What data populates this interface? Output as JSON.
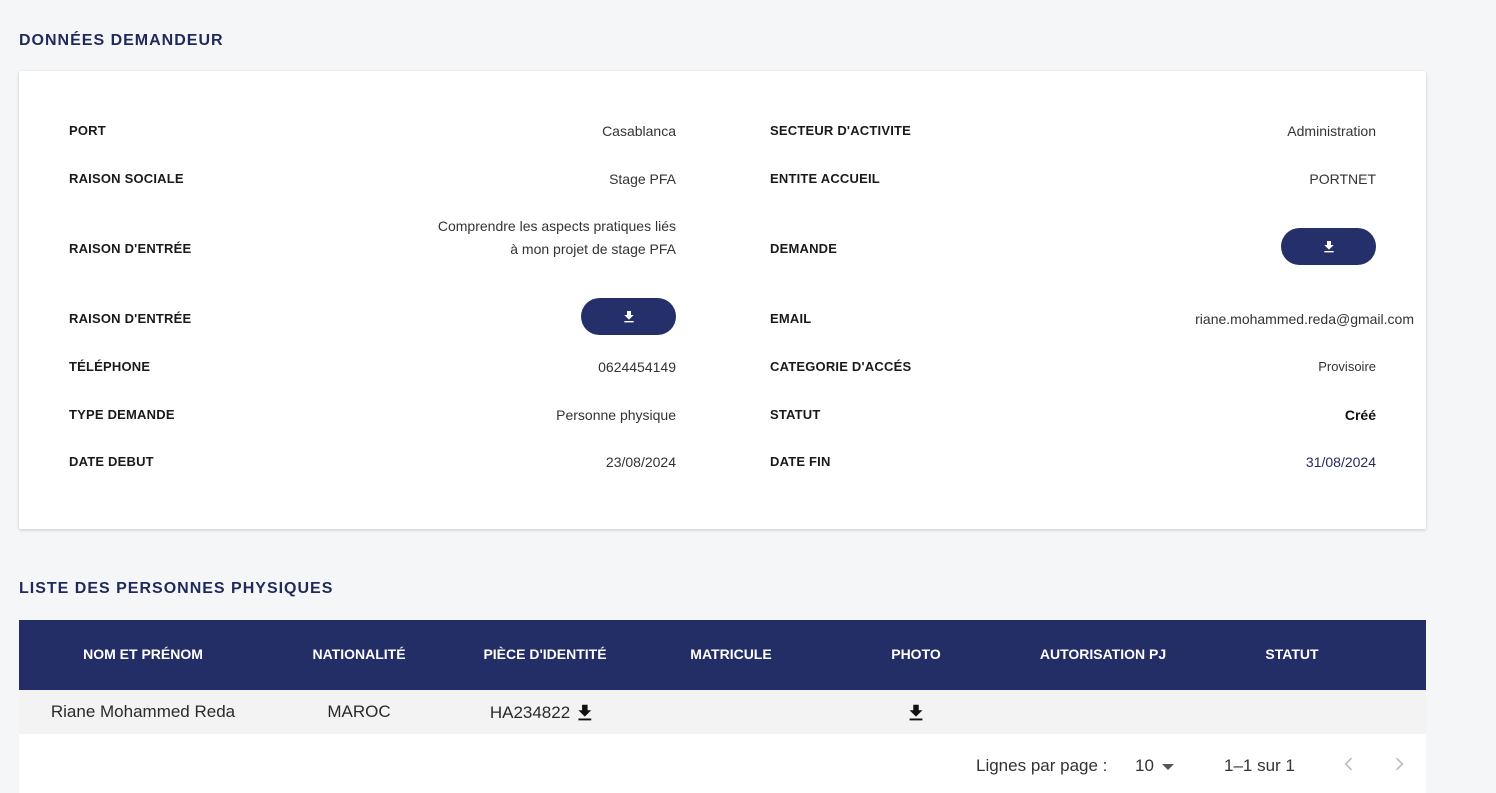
{
  "section1": {
    "title": "DONNÉES DEMANDEUR"
  },
  "details": {
    "port_label": "PORT",
    "port_value": "Casablanca",
    "secteur_label": "SECTEUR D'ACTIVITE",
    "secteur_value": "Administration",
    "raison_sociale_label": "RAISON SOCIALE",
    "raison_sociale_value": "Stage PFA",
    "entite_label": "ENTITE ACCUEIL",
    "entite_value": "PORTNET",
    "raison_entree_label": "RAISON D'ENTRÉE",
    "raison_entree_value": "Comprendre les aspects pratiques liés à mon projet de stage PFA",
    "demande_label": "DEMANDE",
    "raison_entree2_label": "RAISON D'ENTRÉE",
    "email_label": "EMAIL",
    "email_value": "riane.mohammed.reda@gmail.com",
    "telephone_label": "TÉLÉPHONE",
    "telephone_value": "0624454149",
    "categorie_label": "CATEGORIE D'ACCÉS",
    "categorie_value": "Provisoire",
    "type_label": "TYPE DEMANDE",
    "type_value": "Personne physique",
    "statut_label": "STATUT",
    "statut_value": "Créé",
    "date_debut_label": "DATE DEBUT",
    "date_debut_value": "23/08/2024",
    "date_fin_label": "DATE FIN",
    "date_fin_value": "31/08/2024"
  },
  "section2": {
    "title": "LISTE DES PERSONNES PHYSIQUES"
  },
  "table": {
    "headers": [
      "NOM ET PRÉNOM",
      "NATIONALITÉ",
      "PIÈCE D'IDENTITÉ",
      "MATRICULE",
      "PHOTO",
      "AUTORISATION PJ",
      "STATUT"
    ],
    "rows": [
      {
        "nom": "Riane Mohammed Reda",
        "nationalite": "MAROC",
        "piece": "HA234822",
        "matricule": "",
        "autorisation": "",
        "statut": ""
      }
    ]
  },
  "pagination": {
    "rows_label": "Lignes par page :",
    "rows_value": "10",
    "range": "1–1 sur 1"
  },
  "icons": {
    "download": "download-icon",
    "prev": "chevron-left-icon",
    "next": "chevron-right-icon",
    "dropdown": "caret-down-icon"
  },
  "colors": {
    "primary": "#242e66",
    "title": "#1f2a5a",
    "background": "#f5f6f8"
  }
}
